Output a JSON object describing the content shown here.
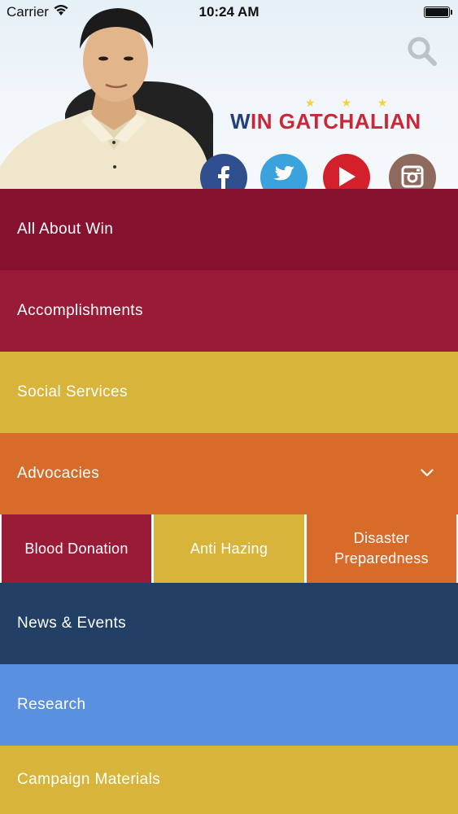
{
  "status_bar": {
    "carrier": "Carrier",
    "time": "10:24 AM",
    "wifi_icon": "wifi-icon",
    "battery_icon": "battery-icon"
  },
  "header": {
    "logo": {
      "stars": "★ ★ ★",
      "name_first": "W",
      "name_rest": "IN GATCHALIAN",
      "colors": {
        "red": "#c8283a",
        "blue": "#24407a",
        "gold": "#f2d23a"
      }
    },
    "search_icon": "search-icon",
    "social": [
      {
        "icon": "facebook-icon",
        "color": "#2f4f8f"
      },
      {
        "icon": "twitter-icon",
        "color": "#3aa2dd"
      },
      {
        "icon": "youtube-icon",
        "color": "#d3202a"
      },
      {
        "icon": "instagram-icon",
        "color": "#8e6a5e"
      }
    ]
  },
  "menu": {
    "items": [
      {
        "label": "All About Win",
        "color": "#86122f"
      },
      {
        "label": "Accomplishments",
        "color": "#9a1b37"
      },
      {
        "label": "Social Services",
        "color": "#d8b43a"
      },
      {
        "label": "Advocacies",
        "color": "#d86a2a",
        "expanded": true
      },
      {
        "label": "News & Events",
        "color": "#223f66"
      },
      {
        "label": "Research",
        "color": "#5a90e0"
      },
      {
        "label": "Campaign Materials",
        "color": "#d8b43a"
      }
    ],
    "advocacies_sub": [
      {
        "label": "Blood Donation",
        "color": "#9a1b37"
      },
      {
        "label": "Anti Hazing",
        "color": "#d8b43a"
      },
      {
        "label": "Disaster Preparedness",
        "color": "#d86a2a"
      }
    ]
  }
}
